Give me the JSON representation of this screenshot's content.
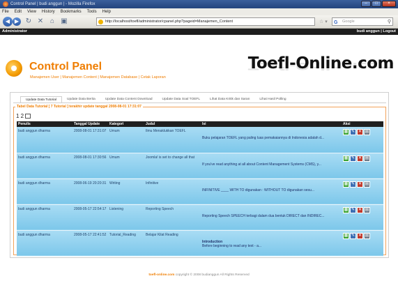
{
  "window": {
    "title": "Control Panel | budi anggun | - Mozilla Firefox"
  },
  "menu": [
    "File",
    "Edit",
    "View",
    "History",
    "Bookmarks",
    "Tools",
    "Help"
  ],
  "browser": {
    "url": "http://localhost/toefl/administrator/cpanel.php?pageid=Manajemen_Content",
    "search_placeholder": "Google"
  },
  "adminbar": {
    "left": "Administrator",
    "right": "budi anggun | Logout"
  },
  "header": {
    "title": "Control Panel",
    "subtitle": "Manajemen User | Manajemen Content | Manajemen Database | Cetak Laporan",
    "brand": "Toefl-Online.com"
  },
  "tabs": [
    "Update Data Tutorial",
    "Update Data Berita",
    "Update Data Content Download",
    "Update Data Soal TOEFL",
    "Lihat Data Kritik dan Saran",
    "Lihat Hasil Polling"
  ],
  "legend": "Tabel Data Tutorial [ 7 Tutorial ] terakhir update tanggal 2008-08-01 17:31:07",
  "pager": "1 2",
  "columns": [
    "Penulis",
    "Tanggal Update",
    "Kategori",
    "Judul",
    "Isi",
    "Aksi"
  ],
  "rows": [
    {
      "penulis": "budi anggun dharma",
      "tanggal": "2008-08-01 17:31:07",
      "kategori": "Umum",
      "judul": "Ilmu Menaklukkan TOEFL",
      "isi": "Buku pelajaran TOEFL yang paling luas pemakaiannya di Indonesia adalah d..."
    },
    {
      "penulis": "budi anggun dharma",
      "tanggal": "2008-08-01 17:30:56",
      "kategori": "Umum",
      "judul": "Joomla! is set to change all that",
      "isi": "If you've read anything at all about Content Management Systems (CMS), y..."
    },
    {
      "penulis": "budi anggun dharma",
      "tanggal": "2008-06-19 20:20:31",
      "kategori": "Writing",
      "judul": "Infinitive",
      "isi": "INFINITIVE ____ WITH TO digunakan : WITHOUT TO digunakan sesu..."
    },
    {
      "penulis": "budi anggun dharma",
      "tanggal": "2008-05-17 22:54:17",
      "kategori": "Listening",
      "judul": "Reporting Speech",
      "isi": "Reporting Speech SPEECH terbagi dalam dua bentuk DIRECT dan INDIREC..."
    },
    {
      "penulis": "budi anggun dharma",
      "tanggal": "2008-05-17 22:41:52",
      "kategori": "Tutorial_Reading",
      "judul": "Belajar Kilat Reading",
      "isi_bold": "Introduction",
      "isi": "Before beginning to read any text - a..."
    }
  ],
  "footer": {
    "site": "toefl-online.com",
    "text": "copyright © 2008 budianggun All Rights Reserved"
  }
}
